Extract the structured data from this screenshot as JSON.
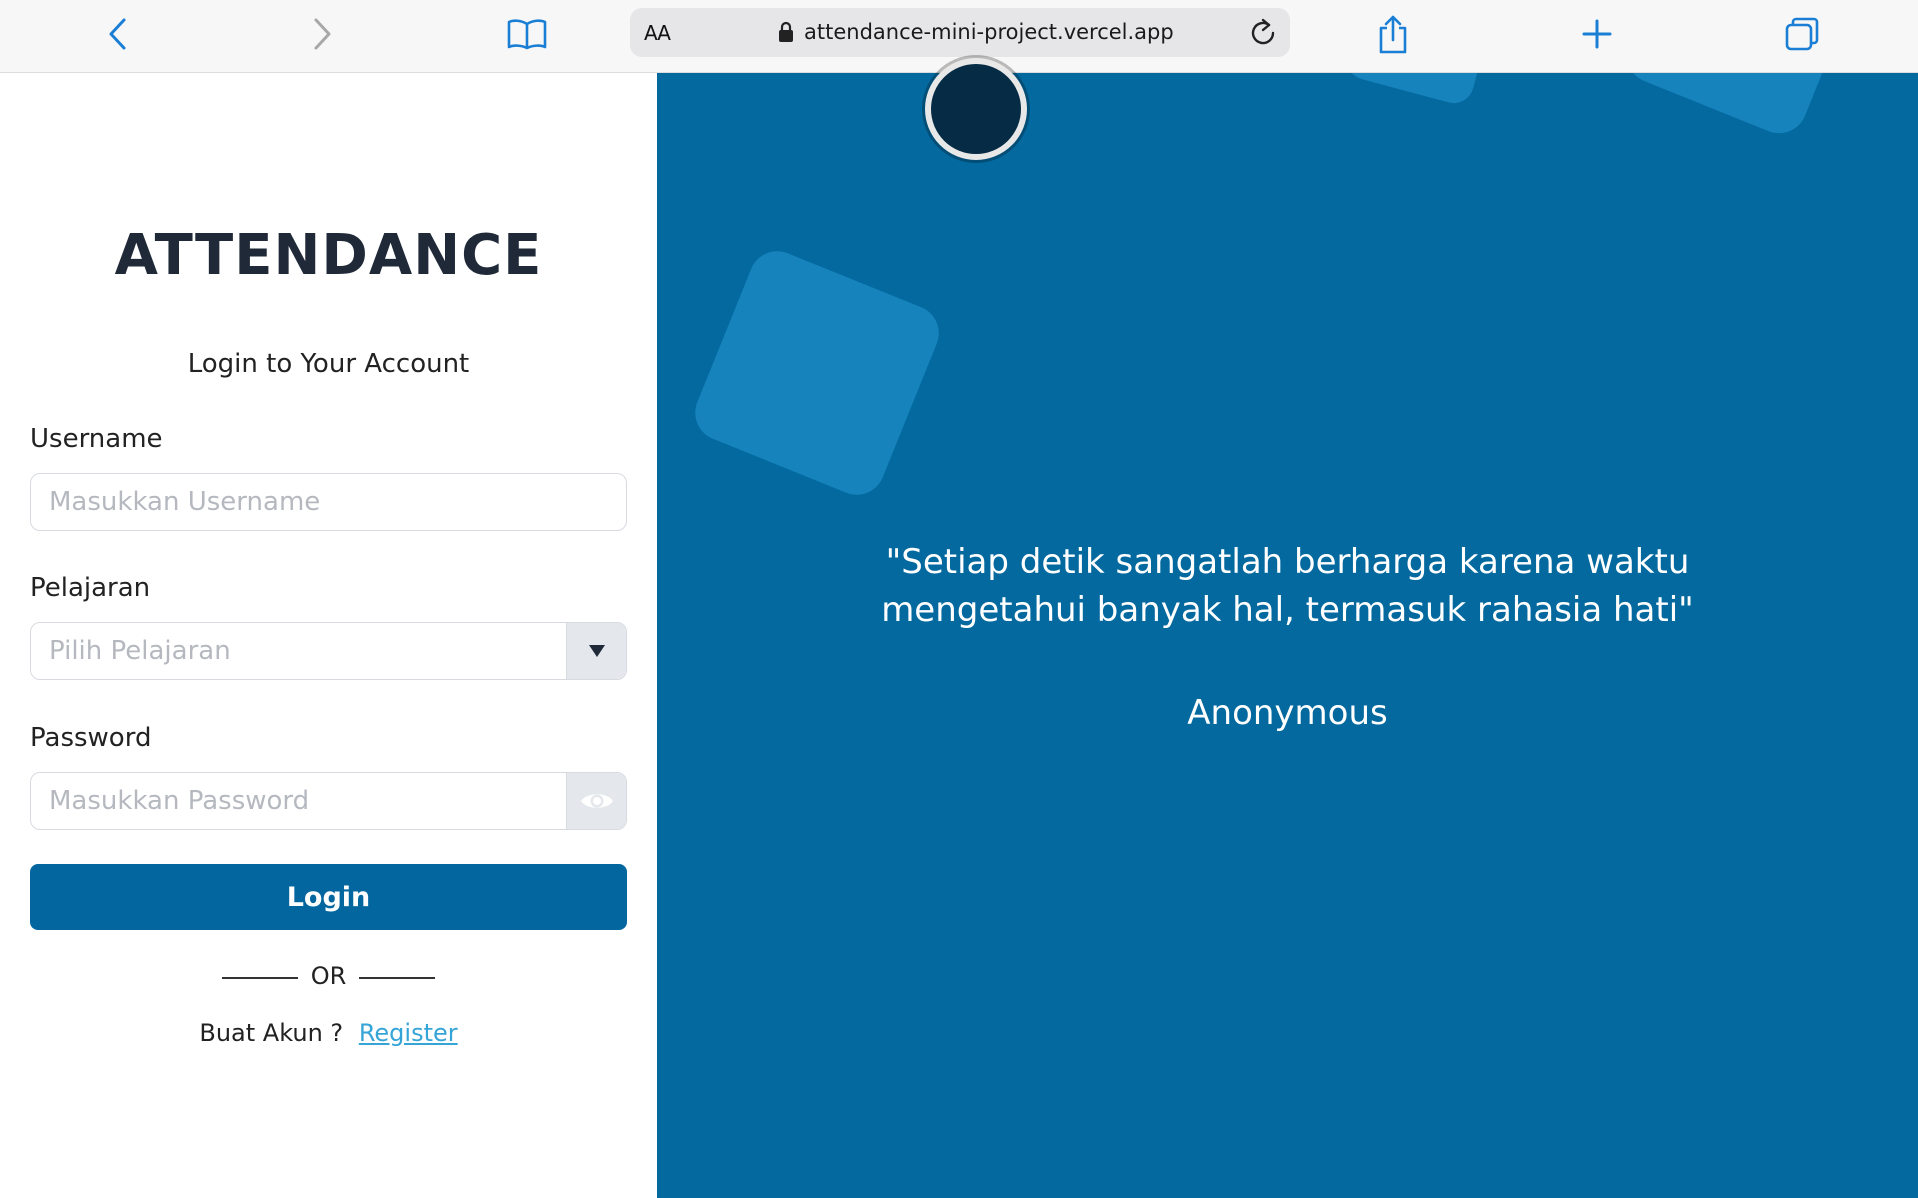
{
  "browser": {
    "text_size_label": "AA",
    "url": "attendance-mini-project.vercel.app",
    "icons": [
      "back-icon",
      "forward-icon",
      "bookmarks-icon",
      "lock-icon",
      "reload-icon",
      "share-icon",
      "new-tab-icon",
      "tabs-icon"
    ]
  },
  "login": {
    "brand": "ATTENDANCE",
    "subtitle": "Login to Your Account",
    "username_label": "Username",
    "username_placeholder": "Masukkan Username",
    "subject_label": "Pelajaran",
    "subject_placeholder": "Pilih Pelajaran",
    "password_label": "Password",
    "password_placeholder": "Masukkan Password",
    "login_button": "Login",
    "or_text": "OR",
    "register_prompt": "Buat Akun ?",
    "register_link": "Register"
  },
  "quote": {
    "line1": "\"Setiap detik sangatlah berharga karena waktu",
    "line2": "mengetahui banyak hal, termasuk rahasia hati\"",
    "author": "Anonymous"
  },
  "colors": {
    "primary": "#03669f",
    "panel_bg": "#04699f",
    "link": "#35a4d7"
  }
}
